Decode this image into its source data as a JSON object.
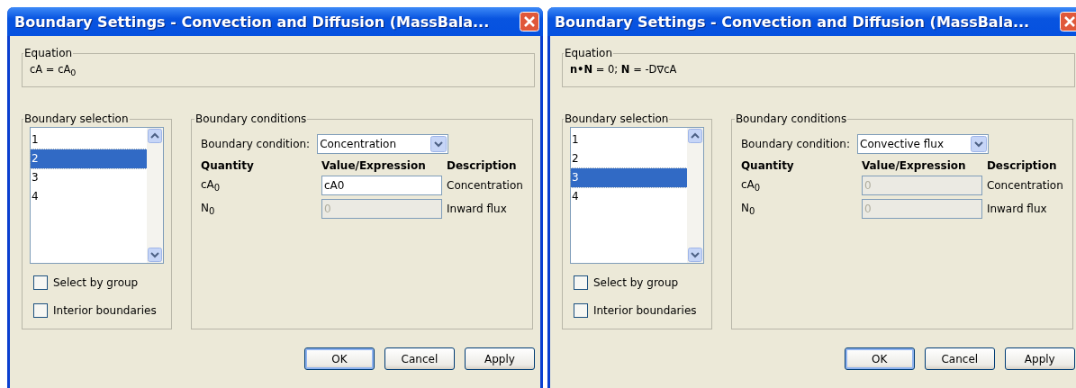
{
  "windows": [
    {
      "title": "Boundary Settings - Convection and Diffusion (MassBala...",
      "equation_label": "Equation",
      "equation": "cA = cA$_{0}$",
      "selection": {
        "label": "Boundary selection",
        "items": [
          {
            "label": "1",
            "selected": false
          },
          {
            "label": "2",
            "selected": true
          },
          {
            "label": "3",
            "selected": false
          },
          {
            "label": "4",
            "selected": false
          }
        ],
        "checkboxes": [
          {
            "label": "Select by group",
            "checked": false
          },
          {
            "label": "Interior boundaries",
            "checked": false
          }
        ]
      },
      "conditions": {
        "label": "Boundary conditions",
        "condition_label": "Boundary condition:",
        "condition_value": "Concentration",
        "columns": [
          "Quantity",
          "Value/Expression",
          "Description"
        ],
        "rows": [
          {
            "quantity": "cA$_{0}$",
            "value": "cA0",
            "disabled": false,
            "description": "Concentration"
          },
          {
            "quantity": "N$_{0}$",
            "value": "0",
            "disabled": true,
            "description": "Inward flux"
          }
        ]
      },
      "buttons": [
        {
          "label": "OK",
          "default": true
        },
        {
          "label": "Cancel",
          "default": false
        },
        {
          "label": "Apply",
          "default": false
        }
      ]
    },
    {
      "title": "Boundary Settings - Convection and Diffusion (MassBala...",
      "equation_label": "Equation",
      "equation": "**n•N** = 0; **N** = -D∇cA",
      "selection": {
        "label": "Boundary selection",
        "items": [
          {
            "label": "1",
            "selected": false
          },
          {
            "label": "2",
            "selected": false
          },
          {
            "label": "3",
            "selected": true
          },
          {
            "label": "4",
            "selected": false
          }
        ],
        "checkboxes": [
          {
            "label": "Select by group",
            "checked": false
          },
          {
            "label": "Interior boundaries",
            "checked": false
          }
        ]
      },
      "conditions": {
        "label": "Boundary conditions",
        "condition_label": "Boundary condition:",
        "condition_value": "Convective flux",
        "columns": [
          "Quantity",
          "Value/Expression",
          "Description"
        ],
        "rows": [
          {
            "quantity": "cA$_{0}$",
            "value": "0",
            "disabled": true,
            "description": "Concentration"
          },
          {
            "quantity": "N$_{0}$",
            "value": "0",
            "disabled": true,
            "description": "Inward flux"
          }
        ]
      },
      "buttons": [
        {
          "label": "OK",
          "default": true
        },
        {
          "label": "Cancel",
          "default": false
        },
        {
          "label": "Apply",
          "default": false
        }
      ]
    }
  ]
}
